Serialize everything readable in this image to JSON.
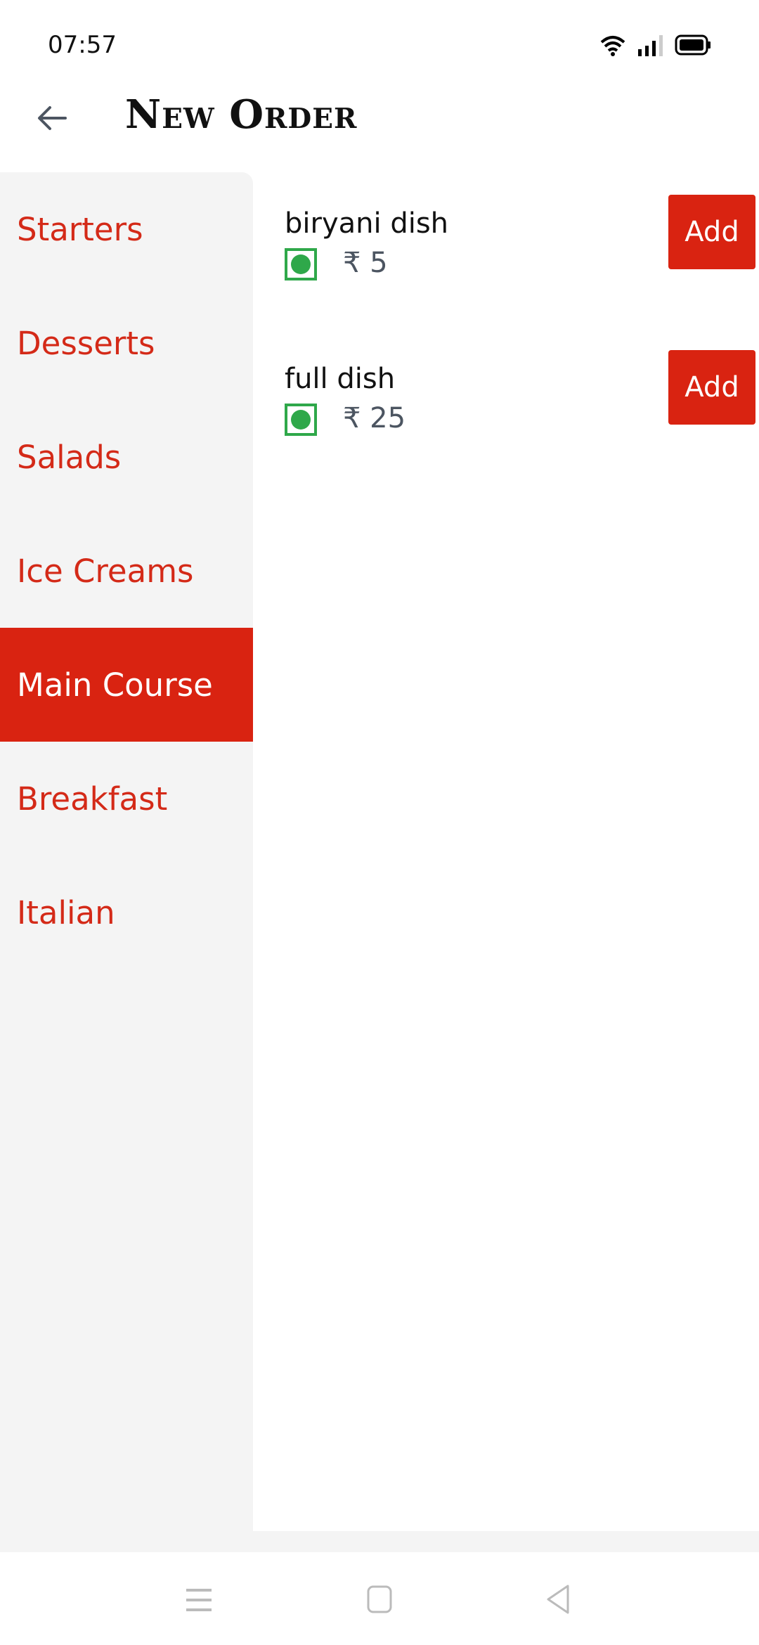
{
  "status_bar": {
    "time": "07:57",
    "icons": [
      "wifi-icon",
      "signal-icon",
      "battery-icon"
    ]
  },
  "header": {
    "title": "New Order",
    "back_icon": "arrow-left-icon"
  },
  "sidebar": {
    "active_index": 4,
    "items": [
      {
        "label": "Starters"
      },
      {
        "label": "Desserts"
      },
      {
        "label": "Salads"
      },
      {
        "label": "Ice Creams"
      },
      {
        "label": "Main Course"
      },
      {
        "label": "Breakfast"
      },
      {
        "label": "Italian"
      }
    ]
  },
  "menu_items": [
    {
      "name": "biryani dish",
      "price": "₹ 5",
      "veg": true,
      "add_label": "Add"
    },
    {
      "name": "full dish",
      "price": "₹ 25",
      "veg": true,
      "add_label": "Add"
    }
  ],
  "nav_bar": {
    "icons": [
      "menu-icon",
      "home-icon",
      "back-icon"
    ]
  },
  "colors": {
    "accent": "#d92311",
    "veg_green": "#2fa84a",
    "sidebar_bg": "#f4f4f4"
  }
}
